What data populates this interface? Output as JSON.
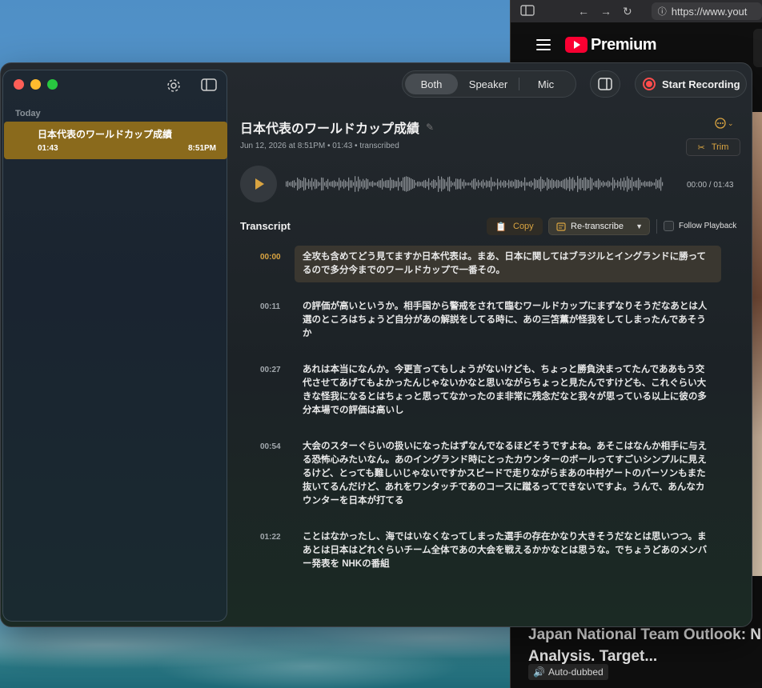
{
  "browser": {
    "url": "https://www.yout",
    "brand": "Premium",
    "video_title": "Japan National Team Outlook: N Analysis. Target...",
    "badge": "Auto-dubbed"
  },
  "app": {
    "sidebar": {
      "section_label": "Today",
      "recordings": [
        {
          "title": "日本代表のワールドカップ成績",
          "duration": "01:43",
          "time": "8:51PM"
        }
      ]
    },
    "toolbar": {
      "modes": [
        "Both",
        "Speaker",
        "Mic"
      ],
      "active_mode": "Both",
      "record_label": "Start Recording"
    },
    "detail": {
      "title": "日本代表のワールドカップ成績",
      "meta": "Jun 12, 2026 at 8:51PM • 01:43 • transcribed",
      "trim_label": "Trim",
      "time_display": "00:00 / 01:43"
    },
    "transcript": {
      "label": "Transcript",
      "copy_label": "Copy",
      "retranscribe_label": "Re-transcribe",
      "follow_label": "Follow Playback",
      "segments": [
        {
          "ts": "00:00",
          "text": "全攻も含めてどう見てますか日本代表は。まあ、日本に関してはブラジルとイングランドに勝ってるので多分今までのワールドカップで一番その。"
        },
        {
          "ts": "00:11",
          "text": "の評価が高いというか。相手国から警戒をされて臨むワールドカップにまずなりそうだなあとは人選のところはちょうど自分があの解説をしてる時に、あの三笘薫が怪我をしてしまったんであそうか"
        },
        {
          "ts": "00:27",
          "text": "あれは本当になんか。今更言ってもしょうがないけども、ちょっと勝負決まってたんでああもう交代させてあげてもよかったんじゃないかなと思いながらちょっと見たんですけども、これぐらい大きな怪我になるとはちょっと思ってなかったのま非常に残念だなと我々が思っている以上に彼の多分本場での評価は高いし"
        },
        {
          "ts": "00:54",
          "text": "大会のスターぐらいの扱いになったはずなんでなるほどそうですよね。あそこはなんか相手に与える恐怖心みたいなん。あのイングランド時にとったカウンターのボールってすごいシンプルに見えるけど、とっても難しいじゃないですかスピードで走りながらまあの中村ゲートのパーソンもまた抜いてるんだけど、あれをワンタッチであのコースに蹴るってできないですよ。うんで、あんなカウンターを日本が打てる"
        },
        {
          "ts": "01:22",
          "text": "ことはなかったし、海ではいなくなってしまった選手の存在かなり大きそうだなとは思いつつ。まあとは日本はどれぐらいチーム全体であの大会を戦えるかかなとは思うな。でちょうどあのメンバー発表を NHKの番組"
        }
      ]
    }
  }
}
